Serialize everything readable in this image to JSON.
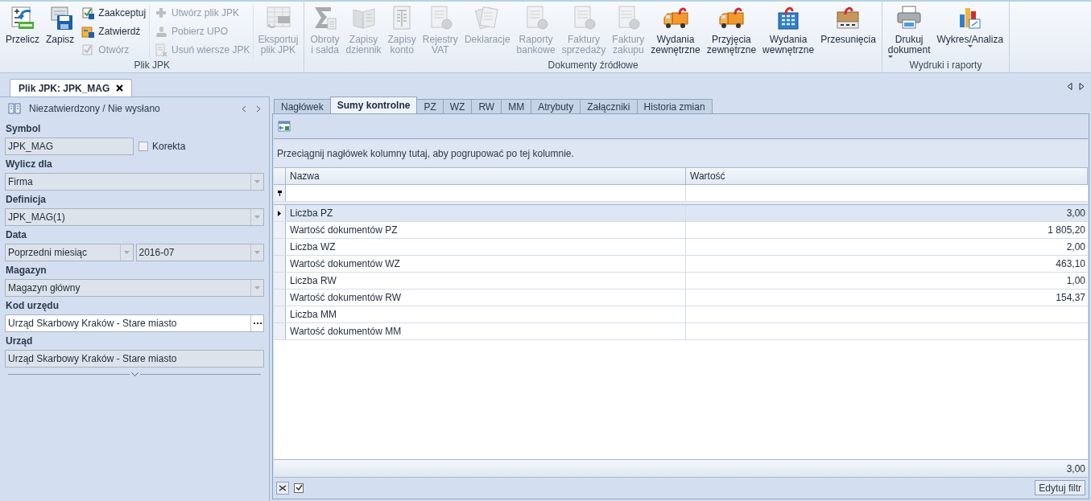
{
  "ribbon": {
    "groups": [
      {
        "label": "Plik JPK",
        "items": [
          {
            "kind": "large",
            "lines": [
              "Przelicz"
            ],
            "disabled": false,
            "dropdown": false
          },
          {
            "kind": "large",
            "lines": [
              "Zapisz"
            ],
            "disabled": false,
            "dropdown": false
          },
          {
            "kind": "stack",
            "buttons": [
              {
                "label": "Zaakceptuj",
                "disabled": false
              },
              {
                "label": "Zatwierdź",
                "disabled": false
              },
              {
                "label": "Otwórz",
                "disabled": true
              }
            ]
          },
          {
            "kind": "stack",
            "buttons": [
              {
                "label": "Utwórz plik JPK",
                "disabled": true
              },
              {
                "label": "Pobierz UPO",
                "disabled": true
              },
              {
                "label": "Usuń wiersze JPK",
                "disabled": true
              }
            ]
          },
          {
            "kind": "large",
            "lines": [
              "Eksportuj",
              "plik JPK"
            ],
            "disabled": true,
            "dropdown": false
          }
        ]
      },
      {
        "label": "Dokumenty źródłowe",
        "items": [
          {
            "kind": "large",
            "lines": [
              "Obroty",
              "i salda"
            ],
            "disabled": true,
            "dropdown": false
          },
          {
            "kind": "large",
            "lines": [
              "Zapisy",
              "dziennik"
            ],
            "disabled": true,
            "dropdown": false
          },
          {
            "kind": "large",
            "lines": [
              "Zapisy",
              "konto"
            ],
            "disabled": true,
            "dropdown": false
          },
          {
            "kind": "large",
            "lines": [
              "Rejestry",
              "VAT"
            ],
            "disabled": true,
            "dropdown": false
          },
          {
            "kind": "large",
            "lines": [
              "Deklaracje"
            ],
            "disabled": true,
            "dropdown": false
          },
          {
            "kind": "large",
            "lines": [
              "Raporty",
              "bankowe"
            ],
            "disabled": true,
            "dropdown": false
          },
          {
            "kind": "large",
            "lines": [
              "Faktury",
              "sprzedaży"
            ],
            "disabled": true,
            "dropdown": false
          },
          {
            "kind": "large",
            "lines": [
              "Faktury",
              "zakupu"
            ],
            "disabled": true,
            "dropdown": false
          },
          {
            "kind": "large",
            "lines": [
              "Wydania",
              "zewnętrzne"
            ],
            "disabled": false,
            "dropdown": false
          },
          {
            "kind": "large",
            "lines": [
              "Przyjęcia",
              "zewnętrzne"
            ],
            "disabled": false,
            "dropdown": false
          },
          {
            "kind": "large",
            "lines": [
              "Wydania",
              "wewnętrzne"
            ],
            "disabled": false,
            "dropdown": false
          },
          {
            "kind": "large",
            "lines": [
              "Przesunięcia"
            ],
            "disabled": false,
            "dropdown": false
          }
        ]
      },
      {
        "label": "Wydruki i raporty",
        "items": [
          {
            "kind": "large",
            "lines": [
              "Drukuj",
              "dokument"
            ],
            "disabled": false,
            "dropdown": true
          },
          {
            "kind": "large",
            "lines": [
              "Wykres/Analiza"
            ],
            "disabled": false,
            "dropdown": true
          }
        ]
      }
    ]
  },
  "document_tabs": [
    {
      "label": "Plik JPK: JPK_MAG",
      "selected": true
    }
  ],
  "form": {
    "status": "Niezatwierdzony / Nie wysłano",
    "fields": [
      {
        "label": "Symbol",
        "controls": [
          {
            "kind": "text",
            "value": "JPK_MAG",
            "readonly": true
          },
          {
            "kind": "checkbox",
            "label": "Korekta",
            "checked": false
          }
        ]
      },
      {
        "label": "Wylicz dla",
        "controls": [
          {
            "kind": "combo",
            "value": "Firma",
            "readonly": true
          }
        ]
      },
      {
        "label": "Definicja",
        "controls": [
          {
            "kind": "combo",
            "value": "JPK_MAG(1)",
            "readonly": true
          }
        ]
      },
      {
        "label": "Data",
        "controls": [
          {
            "kind": "combo",
            "value": "Poprzedni miesiąc",
            "readonly": true
          },
          {
            "kind": "combo",
            "value": "2016-07",
            "readonly": true
          }
        ]
      },
      {
        "label": "Magazyn",
        "controls": [
          {
            "kind": "combo",
            "value": "Magazyn główny",
            "readonly": true
          }
        ]
      },
      {
        "label": "Kod urzędu",
        "controls": [
          {
            "kind": "lookup",
            "value": "Urząd Skarbowy Kraków - Stare miasto",
            "readonly": false
          }
        ]
      },
      {
        "label": "Urząd",
        "controls": [
          {
            "kind": "text",
            "value": "Urząd Skarbowy Kraków - Stare miasto",
            "readonly": true
          }
        ]
      }
    ]
  },
  "tabs": [
    {
      "label": "Nagłówek",
      "selected": false
    },
    {
      "label": "Sumy kontrolne",
      "selected": true
    },
    {
      "label": "PZ",
      "selected": false
    },
    {
      "label": "WZ",
      "selected": false
    },
    {
      "label": "RW",
      "selected": false
    },
    {
      "label": "MM",
      "selected": false
    },
    {
      "label": "Atrybuty",
      "selected": false
    },
    {
      "label": "Załączniki",
      "selected": false
    },
    {
      "label": "Historia zmian",
      "selected": false
    }
  ],
  "grid": {
    "group_hint": "Przeciągnij nagłówek kolumny tutaj, aby pogrupować po tej kolumnie.",
    "columns": [
      "Nazwa",
      "Wartość"
    ],
    "rows": [
      {
        "name": "Liczba PZ",
        "value": "3,00",
        "selected": true
      },
      {
        "name": "Wartość dokumentów PZ",
        "value": "1 805,20",
        "selected": false
      },
      {
        "name": "Liczba WZ",
        "value": "2,00",
        "selected": false
      },
      {
        "name": "Wartość dokumentów WZ",
        "value": "463,10",
        "selected": false
      },
      {
        "name": "Liczba RW",
        "value": "1,00",
        "selected": false
      },
      {
        "name": "Wartość dokumentów RW",
        "value": "154,37",
        "selected": false
      },
      {
        "name": "Liczba MM",
        "selected": false
      },
      {
        "name": "Wartość dokumentów MM",
        "selected": false
      }
    ],
    "footer_total": "3,00",
    "filter_enabled": true,
    "edit_filter_button": "Edytuj filtr"
  }
}
